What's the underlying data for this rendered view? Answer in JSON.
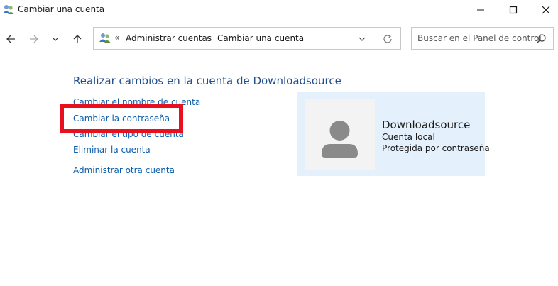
{
  "window": {
    "title": "Cambiar una cuenta",
    "icon": "users-icon"
  },
  "address_bar": {
    "overflow": "«",
    "separator": "›",
    "breadcrumbs": [
      "Administrar cuentas",
      "Cambiar una cuenta"
    ]
  },
  "search": {
    "placeholder": "Buscar en el Panel de control"
  },
  "main": {
    "heading": "Realizar cambios en la cuenta de Downloadsource",
    "links": [
      "Cambiar el nombre de cuenta",
      "Cambiar la contraseña",
      "Cambiar el tipo de cuenta",
      "Eliminar la cuenta",
      "Administrar otra cuenta"
    ]
  },
  "account": {
    "name": "Downloadsource",
    "type": "Cuenta local",
    "protection": "Protegida por contraseña"
  },
  "colors": {
    "link": "#0b5cad",
    "heading": "#1f4e8c",
    "highlight": "#e8101f",
    "card_bg": "#e4f0fb"
  }
}
